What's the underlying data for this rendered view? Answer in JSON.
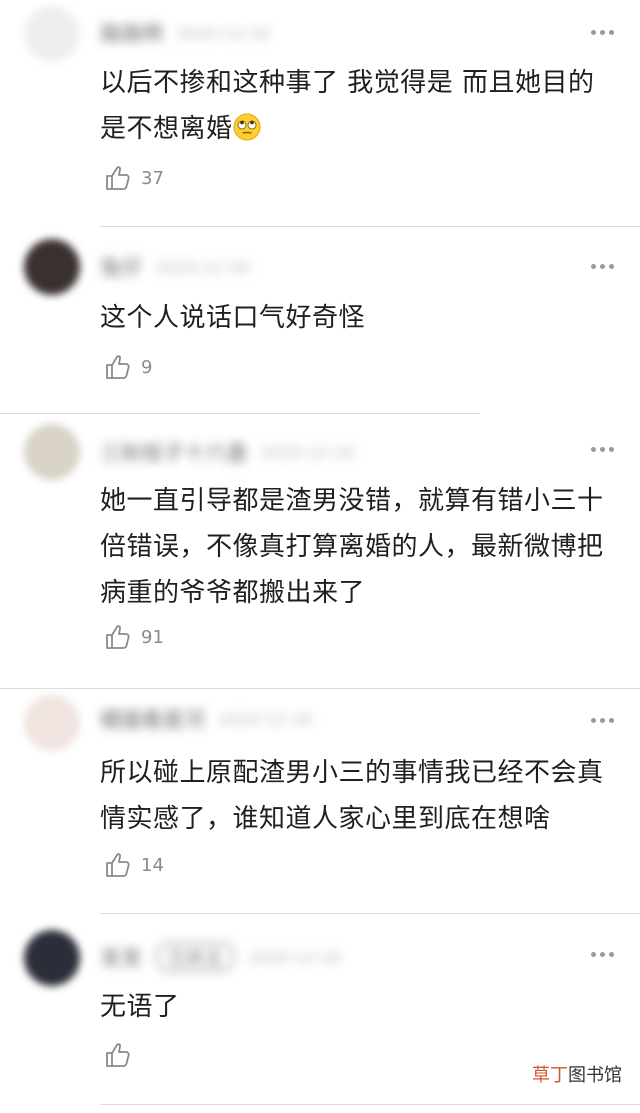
{
  "comments": [
    {
      "avatar_color": "#eeeeee",
      "username": "路路啊",
      "badge": "",
      "time": "2020-12-16",
      "text_lines": [
        "以后不掺和这种事了 我觉得是 而且她目的",
        "是不想离婚"
      ],
      "has_emoji": true,
      "emoji": "face-with-rolling-eyes-icon",
      "likes": "37"
    },
    {
      "avatar_color": "#3a3030",
      "username": "兔仔",
      "badge": "",
      "time": "2020-12-16",
      "text_lines": [
        "这个人说话口气好奇怪"
      ],
      "has_emoji": false,
      "likes": "9"
    },
    {
      "avatar_color": "#d8d3c6",
      "username": "三秋桂子十六盏",
      "badge": "",
      "time": "2020-12-16",
      "text_lines": [
        "她一直引导都是渣男没错，就算有错小三十",
        "倍错误，不像真打算离婚的人，最新微博把",
        "病重的爷爷都搬出来了"
      ],
      "has_emoji": false,
      "likes": "91"
    },
    {
      "avatar_color": "#f0e4e0",
      "username": "橘猫看星河",
      "badge": "",
      "time": "2020-12-16",
      "text_lines": [
        "所以碰上原配渣男小三的事情我已经不会真",
        "情实感了，谁知道人家心里到底在想啥"
      ],
      "has_emoji": false,
      "likes": "14"
    },
    {
      "avatar_color": "#2a2e38",
      "username": "发发",
      "badge": "已关注",
      "time": "2020-12-16",
      "text_lines": [
        "无语了"
      ],
      "has_emoji": false,
      "likes": ""
    }
  ],
  "watermark": {
    "brand": "草丁",
    "suffix": "图书馆"
  }
}
